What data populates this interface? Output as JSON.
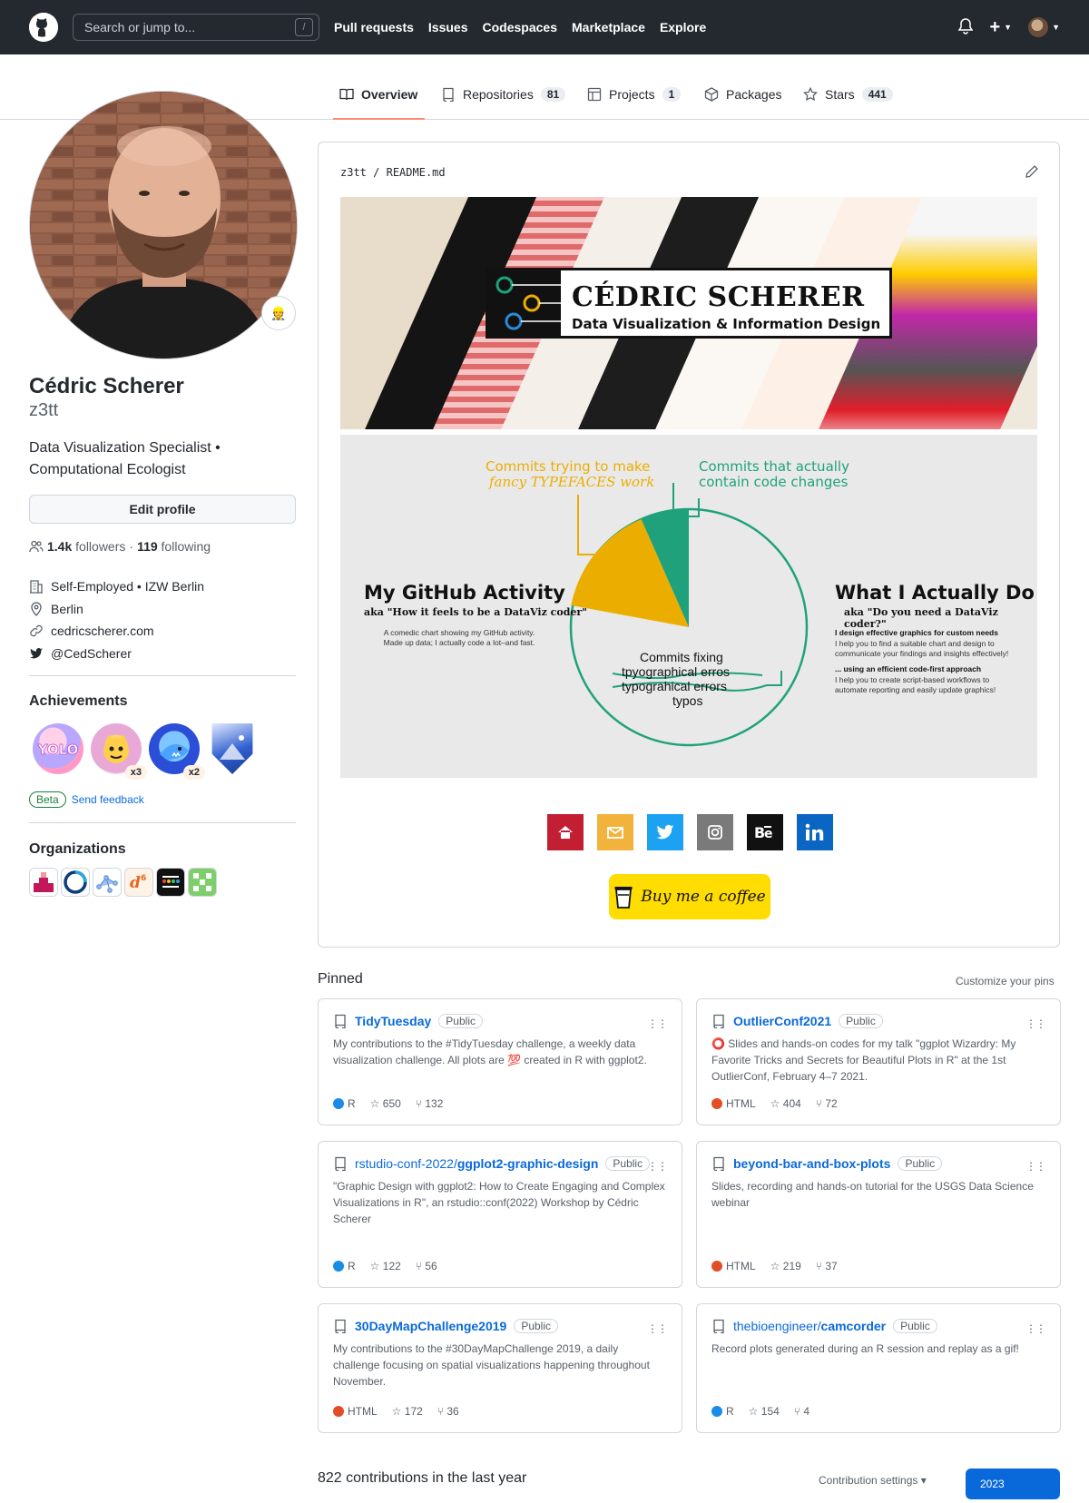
{
  "header": {
    "search_placeholder": "Search or jump to...",
    "search_shortcut": "/",
    "nav": [
      "Pull requests",
      "Issues",
      "Codespaces",
      "Marketplace",
      "Explore"
    ],
    "plus": "+"
  },
  "tabs": {
    "overview": "Overview",
    "repositories": "Repositories",
    "repositories_count": "81",
    "projects": "Projects",
    "projects_count": "1",
    "packages": "Packages",
    "stars": "Stars",
    "stars_count": "441"
  },
  "profile": {
    "name": "Cédric Scherer",
    "login": "z3tt",
    "bio_line1": "Data Visualization Specialist •",
    "bio_line2": "Computational Ecologist",
    "edit_button": "Edit profile",
    "followers_count": "1.4k",
    "followers_label": "followers",
    "separator": "·",
    "following_count": "119",
    "following_label": "following",
    "company": "Self-Employed • IZW Berlin",
    "location": "Berlin",
    "website": "cedricscherer.com",
    "twitter": "@CedScherer"
  },
  "achievements": {
    "title": "Achievements",
    "badges": [
      {
        "name": "yolo",
        "label": "YOLO",
        "multiplier": ""
      },
      {
        "name": "quickdraw",
        "label": "",
        "multiplier": "x3"
      },
      {
        "name": "pull-shark",
        "label": "",
        "multiplier": "x2"
      },
      {
        "name": "arctic-code-vault",
        "label": "",
        "multiplier": ""
      }
    ],
    "beta_label": "Beta",
    "feedback_link": "Send feedback"
  },
  "organizations": {
    "title": "Organizations",
    "items": [
      "org-1",
      "org-2",
      "org-3",
      "org-izw",
      "org-30daychart",
      "org-6"
    ]
  },
  "readme": {
    "path_user": "z3tt",
    "path_sep": "/",
    "path_file": "README.md",
    "banner_title": "CÉDRIC SCHERER",
    "banner_subtitle": "Data Visualization & Information Design",
    "activity": {
      "left_title": "My GitHub Activity",
      "left_aka": "aka \"How it feels to be a DataViz coder\"",
      "left_note": "A comedic chart showing my GitHub activity. Made up data; I actually code a lot–and fast.",
      "right_title": "What I Actually Do",
      "right_aka": "aka \"Do you need a DataViz coder?\"",
      "right_b1": "I design effective graphics for custom needs",
      "right_t1": "I help you to find a suitable chart and design to communicate your findings and insights effectively!",
      "right_b2": "... using an efficient code-first approach",
      "right_t2": "I help you to create script-based workflows to automate reporting and easily update graphics!",
      "label_fancy_1": "Commits trying to make",
      "label_fancy_2": "fancy TYPEFACES work",
      "label_code_1": "Commits that actually",
      "label_code_2": "contain code changes",
      "label_typos_1": "Commits fixing",
      "label_typos_2": "tpyographical erros",
      "label_typos_3": "typograhical errors",
      "label_typos_4": "typos"
    },
    "coffee": "Buy me a coffee",
    "colors": {
      "yellow": "#EBAE00",
      "green": "#1FA27B",
      "gray": "#E9E9E9"
    }
  },
  "pinned": {
    "title": "Pinned",
    "customize": "Customize your pins",
    "repos": [
      {
        "name": "TidyTuesday",
        "vis": "Public",
        "desc": "My contributions to the #TidyTuesday challenge, a weekly data visualization challenge. All plots are 💯 created in R with ggplot2.",
        "lang": "R",
        "color": "#198CE7",
        "stars": "650",
        "forks": "132"
      },
      {
        "name": "OutlierConf2021",
        "vis": "Public",
        "desc": "⭕ Slides and hands-on codes for my talk \"ggplot Wizardry: My Favorite Tricks and Secrets for Beautiful Plots in R\" at the 1st OutlierConf, February 4–7 2021.",
        "lang": "HTML",
        "color": "#E34C26",
        "stars": "404",
        "forks": "72"
      },
      {
        "name_prefix": "rstudio-conf-2022/",
        "name": "ggplot2-graphic-design",
        "vis": "Public",
        "desc": "\"Graphic Design with ggplot2: How to Create Engaging and Complex Visualizations in R\", an rstudio::conf(2022) Workshop by Cédric Scherer",
        "lang": "R",
        "color": "#198CE7",
        "stars": "122",
        "forks": "56"
      },
      {
        "name": "beyond-bar-and-box-plots",
        "vis": "Public",
        "desc": "Slides, recording and hands-on tutorial for the USGS Data Science webinar",
        "lang": "HTML",
        "color": "#E34C26",
        "stars": "219",
        "forks": "37"
      },
      {
        "name": "30DayMapChallenge2019",
        "vis": "Public",
        "desc": "My contributions to the #30DayMapChallenge 2019, a daily challenge focusing on spatial visualizations happening throughout November.",
        "lang": "HTML",
        "color": "#E34C26",
        "stars": "172",
        "forks": "36"
      },
      {
        "name_prefix": "thebioengineer/",
        "name": "camcorder",
        "vis": "Public",
        "desc": "Record plots generated during an R session and replay as a gif!",
        "lang": "R",
        "color": "#198CE7",
        "stars": "154",
        "forks": "4"
      }
    ]
  },
  "contributions": {
    "title": "822 contributions in the last year",
    "settings": "Contribution settings ▾",
    "year": "2023"
  }
}
